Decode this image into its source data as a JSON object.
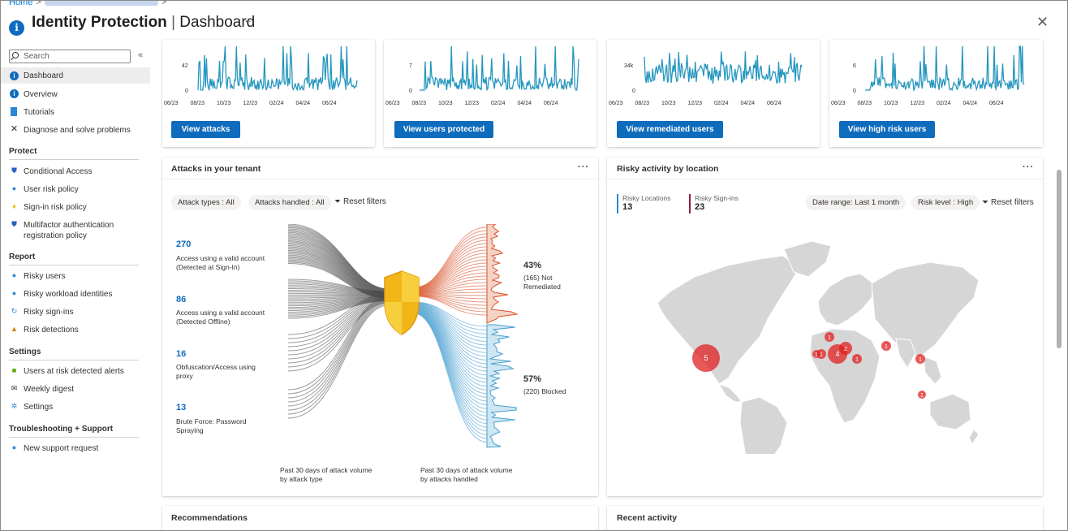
{
  "breadcrumb": {
    "home": "Home"
  },
  "header": {
    "title_main": "Identity Protection",
    "title_sep": " | ",
    "title_sub": "Dashboard",
    "more": "···",
    "close": "✕"
  },
  "sidebar": {
    "search_placeholder": "Search",
    "collapse": "«",
    "top_items": [
      "Dashboard",
      "Overview",
      "Tutorials",
      "Diagnose and solve problems"
    ],
    "sections": {
      "protect": "Protect",
      "report": "Report",
      "settings": "Settings",
      "troubleshooting": "Troubleshooting + Support"
    },
    "protect_items": [
      "Conditional Access",
      "User risk policy",
      "Sign-in risk policy",
      "Multifactor authentication",
      "registration policy"
    ],
    "report_items": [
      "Risky users",
      "Risky workload identities",
      "Risky sign-ins",
      "Risk detections"
    ],
    "settings_items": [
      "Users at risk detected alerts",
      "Weekly digest",
      "Settings"
    ],
    "support_items": [
      "New support request"
    ]
  },
  "top_cards": [
    {
      "button": "View attacks",
      "ymax": "42",
      "ymin": "0",
      "xticks": [
        "06/23",
        "08/23",
        "10/23",
        "12/23",
        "02/24",
        "04/24",
        "06/24"
      ]
    },
    {
      "button": "View users protected",
      "ymax": "7",
      "ymin": "0",
      "xticks": [
        "06/23",
        "08/23",
        "10/23",
        "12/23",
        "02/24",
        "04/24",
        "06/24"
      ]
    },
    {
      "button": "View remediated users",
      "ymax": "34k",
      "ymin": "0",
      "xticks": [
        "06/23",
        "08/23",
        "10/23",
        "12/23",
        "02/24",
        "04/24",
        "06/24"
      ]
    },
    {
      "button": "View high risk users",
      "ymax": "6",
      "ymin": "0",
      "xticks": [
        "06/23",
        "08/23",
        "10/23",
        "12/23",
        "02/24",
        "04/24",
        "06/24"
      ]
    }
  ],
  "attacks": {
    "title": "Attacks in your tenant",
    "more": "···",
    "filters": [
      "Attack types : All",
      "Attacks handled : All"
    ],
    "reset": "Reset filters",
    "types": [
      {
        "count": "270",
        "label1": "Access using a valid account",
        "label2": "(Detected at Sign-In)"
      },
      {
        "count": "86",
        "label1": "Access using a valid account",
        "label2": "(Detected Offline)"
      },
      {
        "count": "16",
        "label1": "Obfuscation/Access using",
        "label2": "proxy"
      },
      {
        "count": "13",
        "label1": "Brute Force: Password",
        "label2": "Spraying"
      }
    ],
    "outcomes": [
      {
        "pct": "43%",
        "label1": "(165) Not",
        "label2": "Remediated"
      },
      {
        "pct": "57%",
        "label1": "(220) Blocked",
        "label2": ""
      }
    ],
    "foot_left1": "Past 30 days of attack volume",
    "foot_left2": "by attack type",
    "foot_right1": "Past 30 days of attack volume",
    "foot_right2": "by attacks handled",
    "colors": {
      "left": "#4a4a4a",
      "not_remediated": "#d9542c",
      "blocked": "#4a9fd0",
      "shield": "#f2b618"
    }
  },
  "risky": {
    "title": "Risky activity by location",
    "more": "···",
    "legend": [
      {
        "label": "Risky Locations",
        "value": "13",
        "color": "#2b88d8"
      },
      {
        "label": "Risky Sign-ins",
        "value": "23",
        "color": "#8b1f4e"
      }
    ],
    "filters": [
      "Date range: Last 1 month",
      "Risk level : High"
    ],
    "reset": "Reset filters",
    "markers": [
      "5",
      "1",
      "1",
      "4",
      "2",
      "1",
      "1",
      "1",
      "1",
      "1"
    ]
  },
  "bottom": {
    "recommendations": "Recommendations",
    "recent": "Recent activity"
  }
}
